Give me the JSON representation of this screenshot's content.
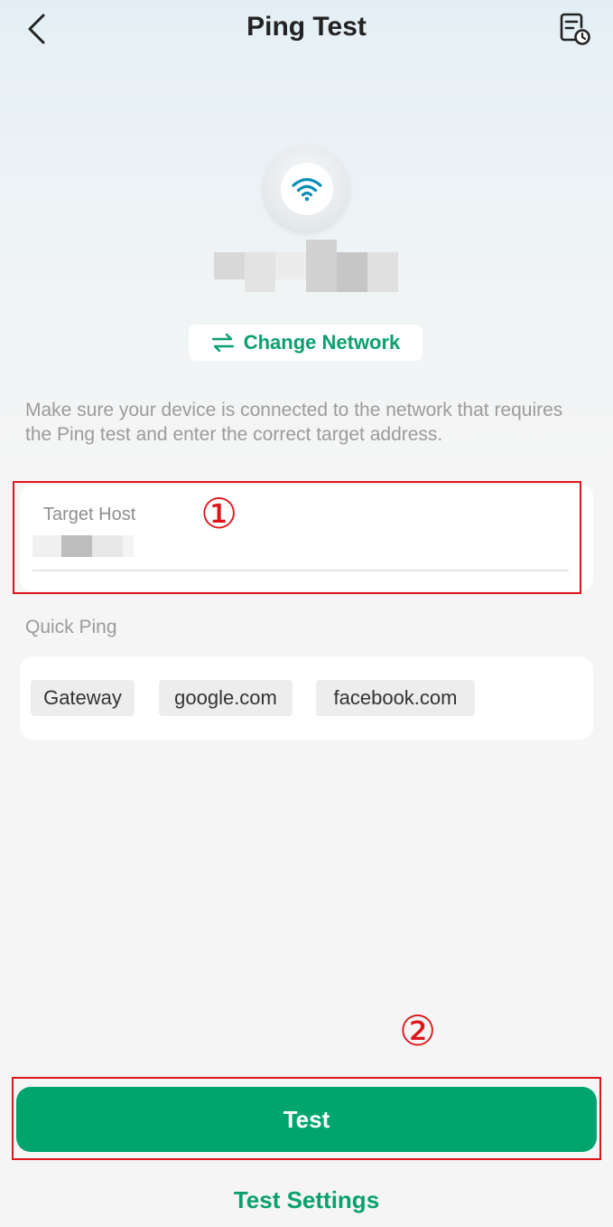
{
  "header": {
    "title": "Ping Test",
    "back_icon": "chevron-left-icon",
    "history_icon": "history-report-icon"
  },
  "device": {
    "icon": "wifi-icon",
    "network_name_redacted": true
  },
  "change_network": {
    "label": "Change Network",
    "icon": "swap-arrows-icon"
  },
  "hint": "Make sure your device is connected to the network that requires the Ping test and enter the correct target address.",
  "target_host": {
    "label": "Target Host",
    "value_redacted": true
  },
  "annotations": {
    "marker_1": "①",
    "marker_2": "②"
  },
  "quick_ping": {
    "label": "Quick Ping",
    "options": [
      "Gateway",
      "google.com",
      "facebook.com"
    ]
  },
  "actions": {
    "test_label": "Test",
    "settings_label": "Test Settings"
  },
  "colors": {
    "accent": "#00a56e",
    "accent_text": "#0aa06e",
    "annotation_red": "#e0141b",
    "hint_gray": "#9b9b9b"
  }
}
